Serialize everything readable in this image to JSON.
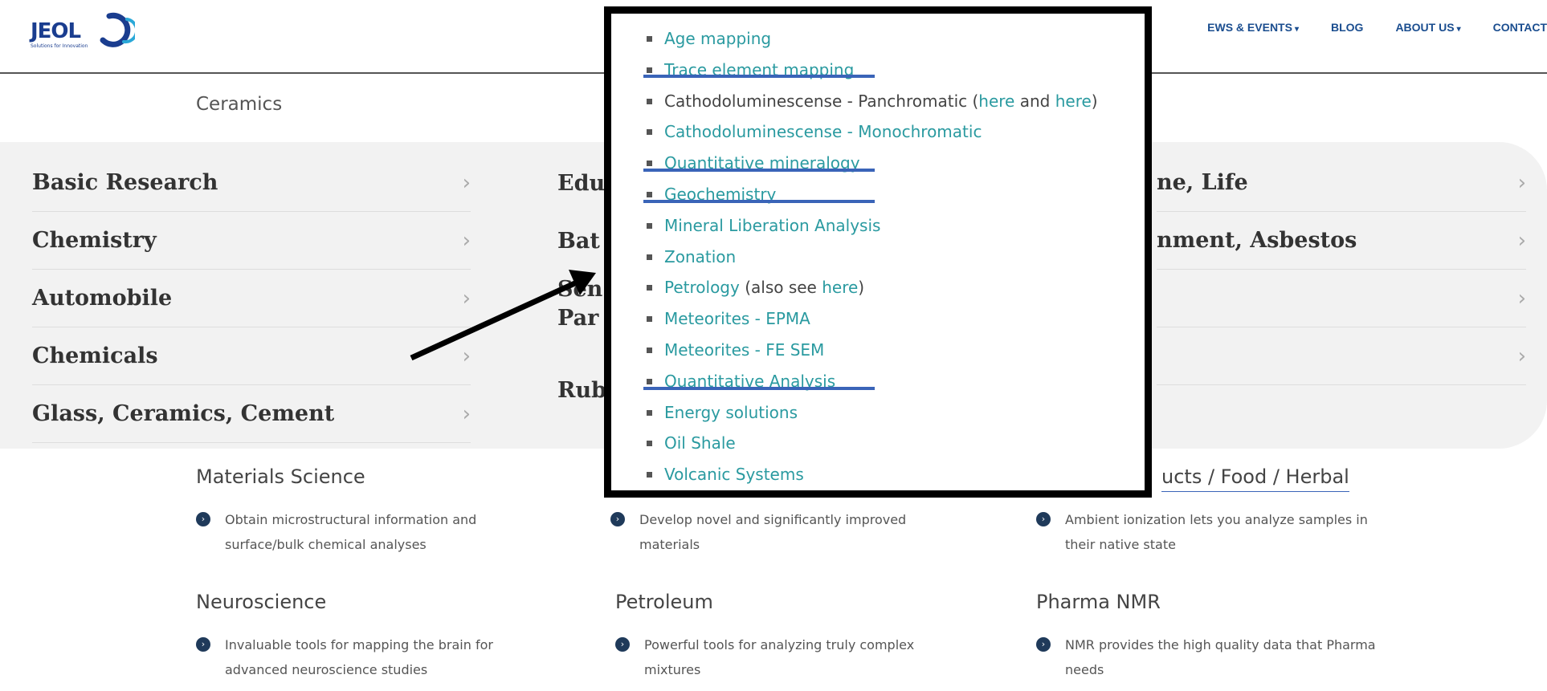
{
  "header": {
    "logo_text": "JEOL",
    "logo_sub": "Solutions for Innovation",
    "nav": [
      {
        "label": "EWS & EVENTS",
        "caret": "▾"
      },
      {
        "label": "BLOG",
        "caret": ""
      },
      {
        "label": "ABOUT US",
        "caret": "▾"
      },
      {
        "label": "CONTACT",
        "caret": ""
      }
    ]
  },
  "section_label": "Ceramics",
  "categories": {
    "col1": [
      "Basic Research",
      "Chemistry",
      "Automobile",
      "Chemicals",
      "Glass, Ceramics, Cement"
    ],
    "col2": [
      "Edu",
      "Bat",
      "Sen",
      "Par",
      "Rub"
    ],
    "col3": [
      "ne, Life",
      "nment, Asbestos",
      "",
      ""
    ]
  },
  "chevron": "›",
  "info": [
    {
      "title": "Materials Science",
      "desc": "Obtain microstructural information and surface/bulk chemical analyses"
    },
    {
      "title": "",
      "desc": "Develop novel and significantly improved materials"
    },
    {
      "title": "ucts / Food / Herbal",
      "desc": "Ambient ionization lets you analyze samples in their native state"
    },
    {
      "title": "Neuroscience",
      "desc": "Invaluable tools for mapping the brain for advanced neuroscience studies"
    },
    {
      "title": "Petroleum",
      "desc": "Powerful tools for analyzing truly complex mixtures"
    },
    {
      "title": "Pharma NMR",
      "desc": "NMR provides the high quality data that Pharma needs"
    }
  ],
  "overlay_list": [
    {
      "parts": [
        {
          "t": "Age mapping",
          "link": true
        }
      ]
    },
    {
      "parts": [
        {
          "t": "Trace element mapping",
          "link": true
        }
      ]
    },
    {
      "parts": [
        {
          "t": "Cathodoluminescense - Panchromatic (",
          "link": false
        },
        {
          "t": "here",
          "link": true
        },
        {
          "t": " and ",
          "link": false
        },
        {
          "t": "here",
          "link": true
        },
        {
          "t": ")",
          "link": false
        }
      ]
    },
    {
      "parts": [
        {
          "t": "Cathodoluminescense - Monochromatic",
          "link": true
        }
      ]
    },
    {
      "parts": [
        {
          "t": "Quantitative mineralogy",
          "link": true
        }
      ]
    },
    {
      "parts": [
        {
          "t": "Geochemistry",
          "link": true
        }
      ]
    },
    {
      "parts": [
        {
          "t": "Mineral Liberation Analysis",
          "link": true
        }
      ]
    },
    {
      "parts": [
        {
          "t": "Zonation",
          "link": true
        }
      ]
    },
    {
      "parts": [
        {
          "t": "Petrology",
          "link": true
        },
        {
          "t": " (also see ",
          "link": false
        },
        {
          "t": "here",
          "link": true
        },
        {
          "t": ")",
          "link": false
        }
      ]
    },
    {
      "parts": [
        {
          "t": "Meteorites - EPMA",
          "link": true
        }
      ]
    },
    {
      "parts": [
        {
          "t": "Meteorites - FE SEM",
          "link": true
        }
      ]
    },
    {
      "parts": [
        {
          "t": "Quantitative Analysis",
          "link": true
        }
      ]
    },
    {
      "parts": [
        {
          "t": "Energy solutions",
          "link": true
        }
      ]
    },
    {
      "parts": [
        {
          "t": "Oil Shale",
          "link": true
        }
      ]
    },
    {
      "parts": [
        {
          "t": "Volcanic Systems",
          "link": true
        }
      ]
    }
  ],
  "colors": {
    "link": "#2a9aa0",
    "underline": "#3a64b8",
    "nav": "#1a4d8f"
  }
}
